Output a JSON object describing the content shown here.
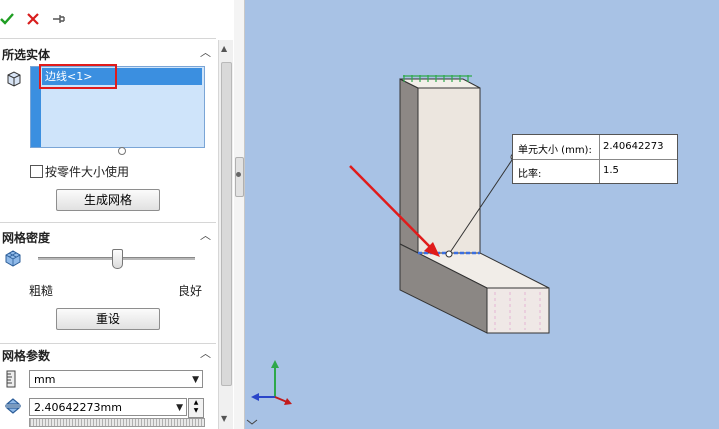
{
  "toolbar": {
    "ok_icon": "check-icon",
    "cancel_icon": "x-icon",
    "pin_icon": "pushpin-icon",
    "ok_color": "#1f9e23",
    "cancel_color": "#d81d1d"
  },
  "selected_entities": {
    "title": "所选实体",
    "items": [
      "边线<1>"
    ],
    "checkbox_label": "按零件大小使用",
    "checkbox_checked": false,
    "generate_button": "生成网格"
  },
  "mesh_density": {
    "title": "网格密度",
    "coarse_label": "粗糙",
    "fine_label": "良好",
    "slider_level": 0.5,
    "reset_button": "重设"
  },
  "mesh_params": {
    "title": "网格参数",
    "unit": "mm",
    "element_size": "2.40642273mm"
  },
  "callout": {
    "size_label": "单元大小 (mm):",
    "size_value": "2.40642273",
    "ratio_label": "比率:",
    "ratio_value": "1.5"
  },
  "colors": {
    "viewport_bg": "#a8c2e5",
    "highlight_red": "#e01b1b",
    "list_selected": "#3b8fe0"
  }
}
